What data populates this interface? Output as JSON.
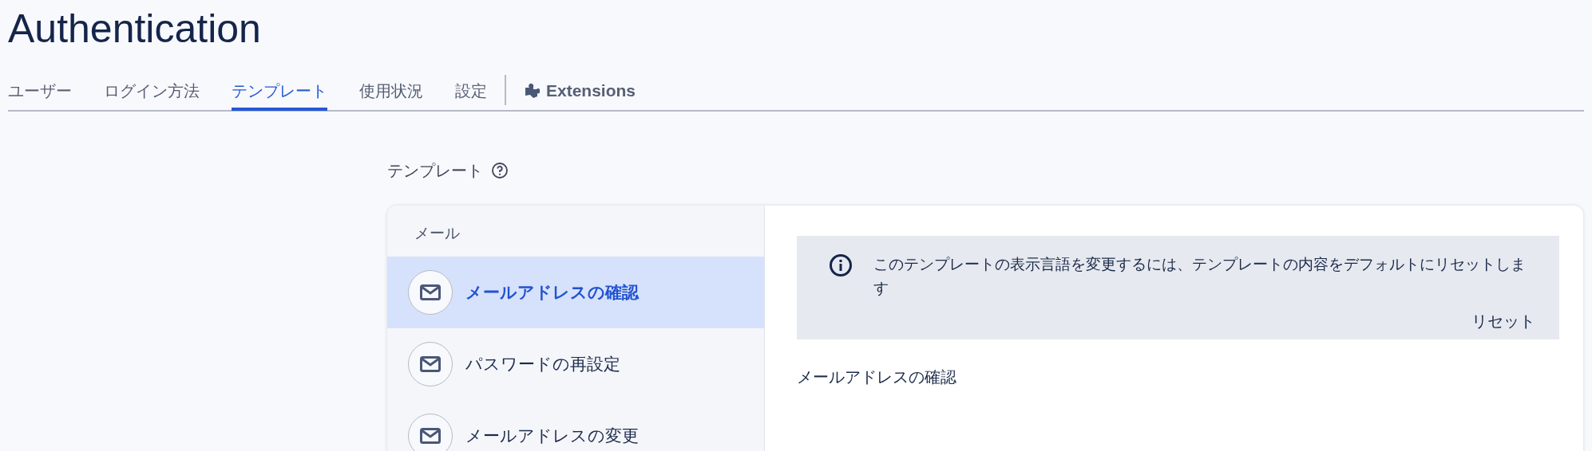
{
  "page_title": "Authentication",
  "tabs": [
    {
      "label": "ユーザー",
      "selected": false
    },
    {
      "label": "ログイン方法",
      "selected": false
    },
    {
      "label": "テンプレート",
      "selected": true
    },
    {
      "label": "使用状況",
      "selected": false
    },
    {
      "label": "設定",
      "selected": false
    }
  ],
  "extensions_tab": {
    "label": "Extensions",
    "selected": false
  },
  "section_title": "テンプレート",
  "sidebar": {
    "group_label": "メール",
    "items": [
      {
        "label": "メールアドレスの確認",
        "selected": true
      },
      {
        "label": "パスワードの再設定",
        "selected": false
      },
      {
        "label": "メールアドレスの変更",
        "selected": false
      }
    ]
  },
  "notice": {
    "text": "このテンプレートの表示言語を変更するには、テンプレートの内容をデフォルトにリセットします",
    "action": "リセット"
  },
  "detail_title": "メールアドレスの確認"
}
